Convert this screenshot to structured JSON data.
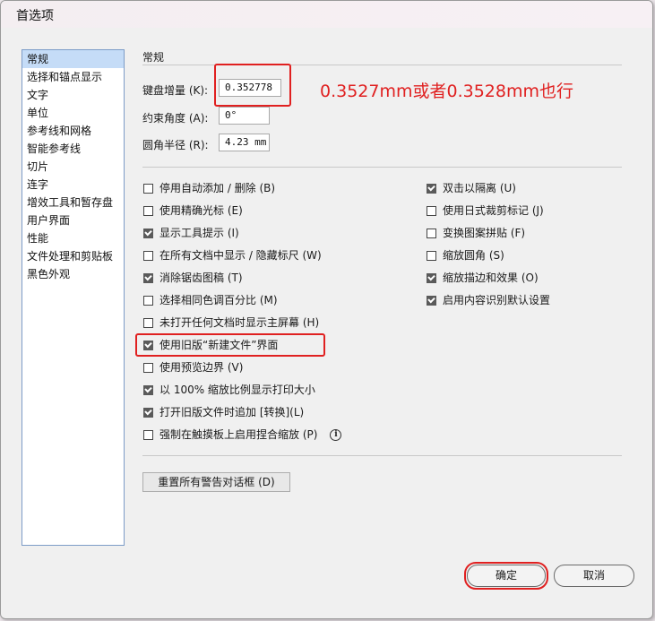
{
  "window": {
    "title": "首选项"
  },
  "sidebar": {
    "items": [
      {
        "label": "常规",
        "selected": true
      },
      {
        "label": "选择和锚点显示",
        "selected": false
      },
      {
        "label": "文字",
        "selected": false
      },
      {
        "label": "单位",
        "selected": false
      },
      {
        "label": "参考线和网格",
        "selected": false
      },
      {
        "label": "智能参考线",
        "selected": false
      },
      {
        "label": "切片",
        "selected": false
      },
      {
        "label": "连字",
        "selected": false
      },
      {
        "label": "增效工具和暂存盘",
        "selected": false
      },
      {
        "label": "用户界面",
        "selected": false
      },
      {
        "label": "性能",
        "selected": false
      },
      {
        "label": "文件处理和剪贴板",
        "selected": false
      },
      {
        "label": "黑色外观",
        "selected": false
      }
    ]
  },
  "general": {
    "group_title": "常规",
    "keyboard_increment": {
      "label": "键盘增量 (K):",
      "value": "0.352778"
    },
    "constrain_angle": {
      "label": "约束角度 (A):",
      "value": "0°"
    },
    "corner_radius": {
      "label": "圆角半径 (R):",
      "value": "4.23 mm"
    },
    "annotation": "0.3527mm或者0.3528mm也行",
    "left_options": [
      {
        "label": "停用自动添加 / 删除 (B)",
        "checked": false
      },
      {
        "label": "使用精确光标 (E)",
        "checked": false
      },
      {
        "label": "显示工具提示 (I)",
        "checked": true
      },
      {
        "label": "在所有文档中显示 / 隐藏标尺 (W)",
        "checked": false
      },
      {
        "label": "消除锯齿图稿 (T)",
        "checked": true
      },
      {
        "label": "选择相同色调百分比 (M)",
        "checked": false
      },
      {
        "label": "未打开任何文档时显示主屏幕 (H)",
        "checked": false
      },
      {
        "label": "使用旧版“新建文件”界面",
        "checked": true
      },
      {
        "label": "使用预览边界 (V)",
        "checked": false
      },
      {
        "label": "以 100% 缩放比例显示打印大小",
        "checked": true
      },
      {
        "label": "打开旧版文件时追加 [转换](L)",
        "checked": true
      },
      {
        "label": "强制在触摸板上启用捏合缩放 (P)",
        "checked": false
      }
    ],
    "right_options": [
      {
        "label": "双击以隔离 (U)",
        "checked": true
      },
      {
        "label": "使用日式裁剪标记 (J)",
        "checked": false
      },
      {
        "label": "变换图案拼贴 (F)",
        "checked": false
      },
      {
        "label": "缩放圆角 (S)",
        "checked": false
      },
      {
        "label": "缩放描边和效果 (O)",
        "checked": true
      },
      {
        "label": "启用内容识别默认设置",
        "checked": true
      }
    ],
    "info_icon": "info-icon",
    "reset_warnings_label": "重置所有警告对话框 (D)"
  },
  "footer": {
    "ok_label": "确定",
    "cancel_label": "取消"
  },
  "colors": {
    "highlight": "#e02020",
    "sidebar_selected": "#c5dcf7"
  }
}
